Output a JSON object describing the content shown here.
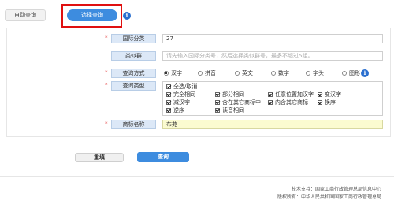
{
  "tabs": {
    "auto_search": "自动查询",
    "select_search": "选择查询"
  },
  "form": {
    "intl_class": {
      "label": "国际分类",
      "value": "27"
    },
    "similar_group": {
      "label": "类似群",
      "placeholder": "请先输入国际分类号，然后选择类似群号，最多不超过5组。"
    },
    "search_method": {
      "label": "查询方式",
      "options": [
        "汉字",
        "拼音",
        "英文",
        "数字",
        "字头",
        "图形"
      ],
      "selected": "汉字"
    },
    "search_type": {
      "label": "查询类型",
      "select_all": "全选/取消",
      "options": [
        "完全相同",
        "部分相同",
        "任意位置加汉字",
        "变汉字",
        "减汉字",
        "含在其它商标中",
        "内含其它商标",
        "换序",
        "逆序",
        "读音相同"
      ]
    },
    "trademark_name": {
      "label": "商标名称",
      "value": "布苑"
    }
  },
  "buttons": {
    "reset": "重填",
    "query": "查询"
  },
  "footer": {
    "tech_support": "技术支持：国家工商行政管理总局信息中心",
    "copyright": "版权所有：中华人民共和国国家工商行政管理总局"
  },
  "colors": {
    "accent": "#3d8cdf",
    "highlight": "#e01010",
    "required_star": "#e02020"
  }
}
